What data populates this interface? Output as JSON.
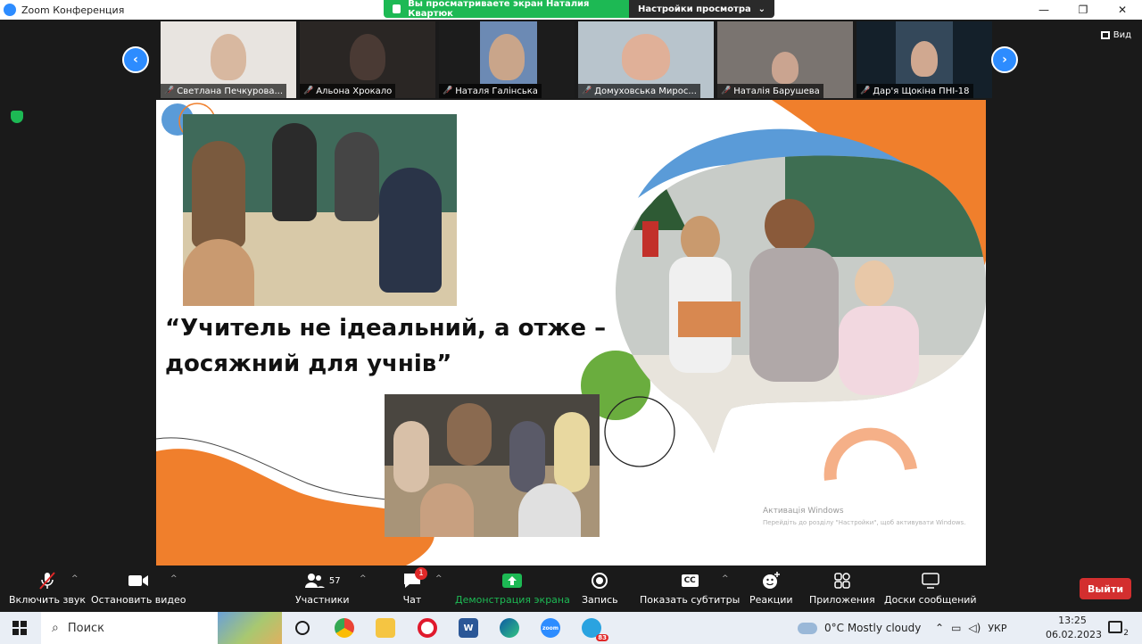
{
  "window": {
    "title": "Zoom Конференция",
    "min": "—",
    "max": "❐",
    "close": "✕"
  },
  "banner": {
    "viewing": "Вы просматриваете экран Наталия Квартюк",
    "settings": "Настройки просмотра",
    "settings_caret": "⌄"
  },
  "view_button": "Вид",
  "participants_thumbs": [
    {
      "name": "Светлана Печкурова..."
    },
    {
      "name": "Альона Хрокало"
    },
    {
      "name": "Наталя Галінська"
    },
    {
      "name": "Домуховська Мирос..."
    },
    {
      "name": "Наталія Барушева"
    },
    {
      "name": "Дар'я Щокіна ПНІ-18"
    }
  ],
  "slide": {
    "quote_line1": "“Учитель не ідеальний, а отже –",
    "quote_line2": "досяжний для учнів”",
    "watermark_title": "Активація Windows",
    "watermark_text": "Перейдіть до розділу \"Настройки\", щоб активувати Windows."
  },
  "toolbar": {
    "unmute": "Включить звук",
    "stop_video": "Остановить видео",
    "participants": "Участники",
    "participants_count": "57",
    "chat": "Чат",
    "chat_badge": "1",
    "share": "Демонстрация экрана",
    "record": "Запись",
    "captions": "Показать субтитры",
    "captions_icon": "CC",
    "reactions": "Реакции",
    "apps": "Приложения",
    "whiteboards": "Доски сообщений",
    "exit": "Выйти",
    "caret": "^"
  },
  "taskbar": {
    "search_placeholder": "Поиск",
    "weather": "0°C  Mostly cloudy",
    "lang": "УКР",
    "time": "13:25",
    "date": "06.02.2023",
    "notif_count": "2",
    "zoom_label": "zoom",
    "word_label": "W",
    "telegram_badge": "83"
  },
  "colors": {
    "zoom_blue": "#2d8cff",
    "share_green": "#1db954",
    "slide_orange": "#f07f2c",
    "slide_blue": "#5a9bd8",
    "slide_green": "#6aad3e",
    "exit_red": "#d32f2f"
  }
}
